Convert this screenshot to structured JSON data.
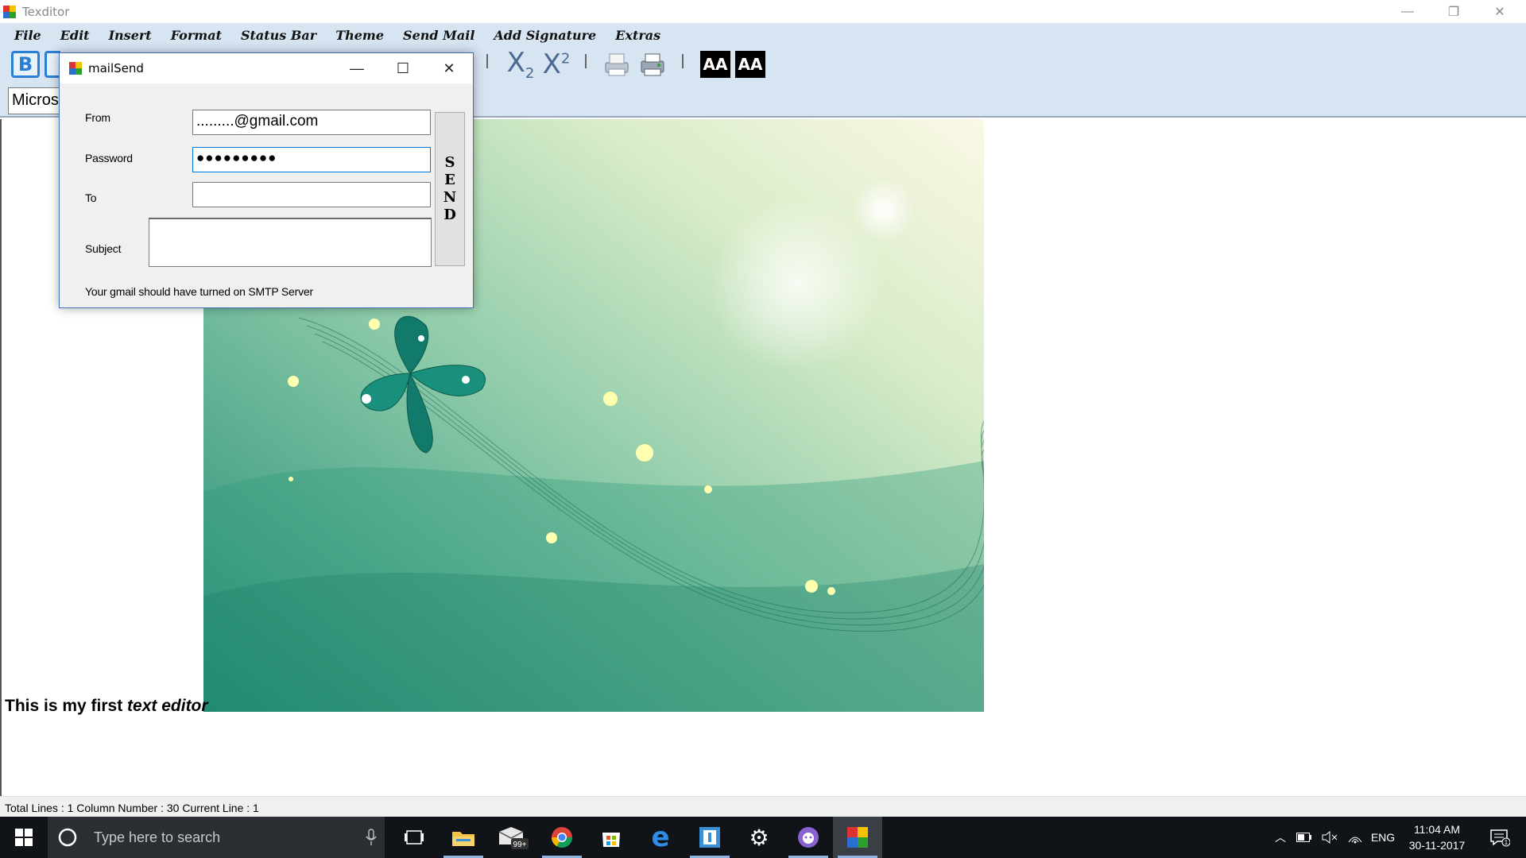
{
  "window": {
    "title": "Texditor",
    "controls": {
      "minimize": "—",
      "restore": "❐",
      "close": "✕"
    }
  },
  "menu": [
    "File",
    "Edit",
    "Insert",
    "Format",
    "Status Bar",
    "Theme",
    "Send Mail",
    "Add Signature",
    "Extras"
  ],
  "toolbar": {
    "bold": "B",
    "subscript": {
      "base": "X",
      "sub": "2"
    },
    "superscript": {
      "base": "X",
      "sup": "2"
    },
    "font_grow": "AA",
    "font_shrink": "AA"
  },
  "fontbar": {
    "font_name": "Microsoft Sans Serif"
  },
  "document": {
    "text_plain": "This is my first ",
    "text_italic": "text editor"
  },
  "statusbar": {
    "text": "Total Lines : 1  Column Number : 30  Current Line : 1"
  },
  "dialog": {
    "title": "mailSend",
    "from_label": "From",
    "from_value": ".........@gmail.com",
    "password_label": "Password",
    "password_value": "●●●●●●●●●",
    "to_label": "To",
    "to_value": "",
    "subject_label": "Subject",
    "subject_value": "",
    "send_letters": [
      "S",
      "E",
      "N",
      "D"
    ],
    "note": "Your gmail should have turned on SMTP Server",
    "controls": {
      "minimize": "—",
      "maximize": "☐",
      "close": "✕"
    }
  },
  "taskbar": {
    "search_placeholder": "Type here to search",
    "mail_badge": "99+",
    "language": "ENG",
    "time": "11:04 AM",
    "date": "30-11-2017",
    "notification_count": "1"
  },
  "colors": {
    "menubar": "#d7e4f2",
    "taskbar": "#101418",
    "accent": "#3f6fb6"
  }
}
